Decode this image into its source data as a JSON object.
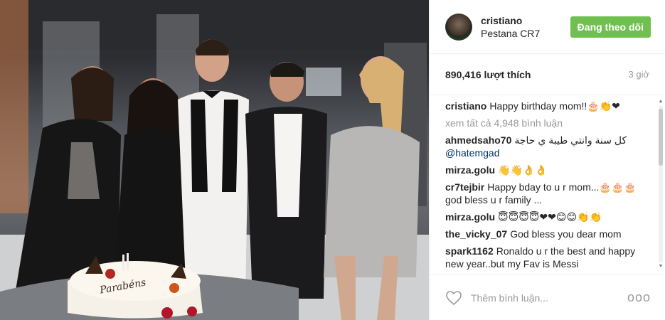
{
  "photo": {
    "cake_text": "Parabéns"
  },
  "header": {
    "username": "cristiano",
    "location": "Pestana CR7",
    "follow_label": "Đang theo dõi"
  },
  "stats": {
    "likes": "890,416 lượt thích",
    "time": "3 giờ"
  },
  "caption": {
    "user": "cristiano",
    "text": "Happy birthday mom!!🎂👏❤"
  },
  "view_all": "xem tất cả 4,948 bình luận",
  "comments": [
    {
      "user": "ahmedsaho70",
      "text": "كل سنة وانتي طيبة ي حاجة",
      "mention": "@hatemgad"
    },
    {
      "user": "mirza.golu",
      "text": "👋👋👌👌"
    },
    {
      "user": "cr7tejbir",
      "text": "Happy bday to u r mom...🎂🎂🎂 god bless u r family ..."
    },
    {
      "user": "mirza.golu",
      "text": "😇😇😇😇❤❤😊😊👏👏"
    },
    {
      "user": "the_vicky_07",
      "text": "God bless you dear mom"
    },
    {
      "user": "spark1162",
      "text": "Ronaldo u r the best and happy new year..but my Fav is Messi"
    }
  ],
  "footer": {
    "placeholder": "Thêm bình luận...",
    "more": "ooo"
  },
  "icons": {
    "heart": "heart-outline-icon",
    "more": "more-options-icon"
  }
}
